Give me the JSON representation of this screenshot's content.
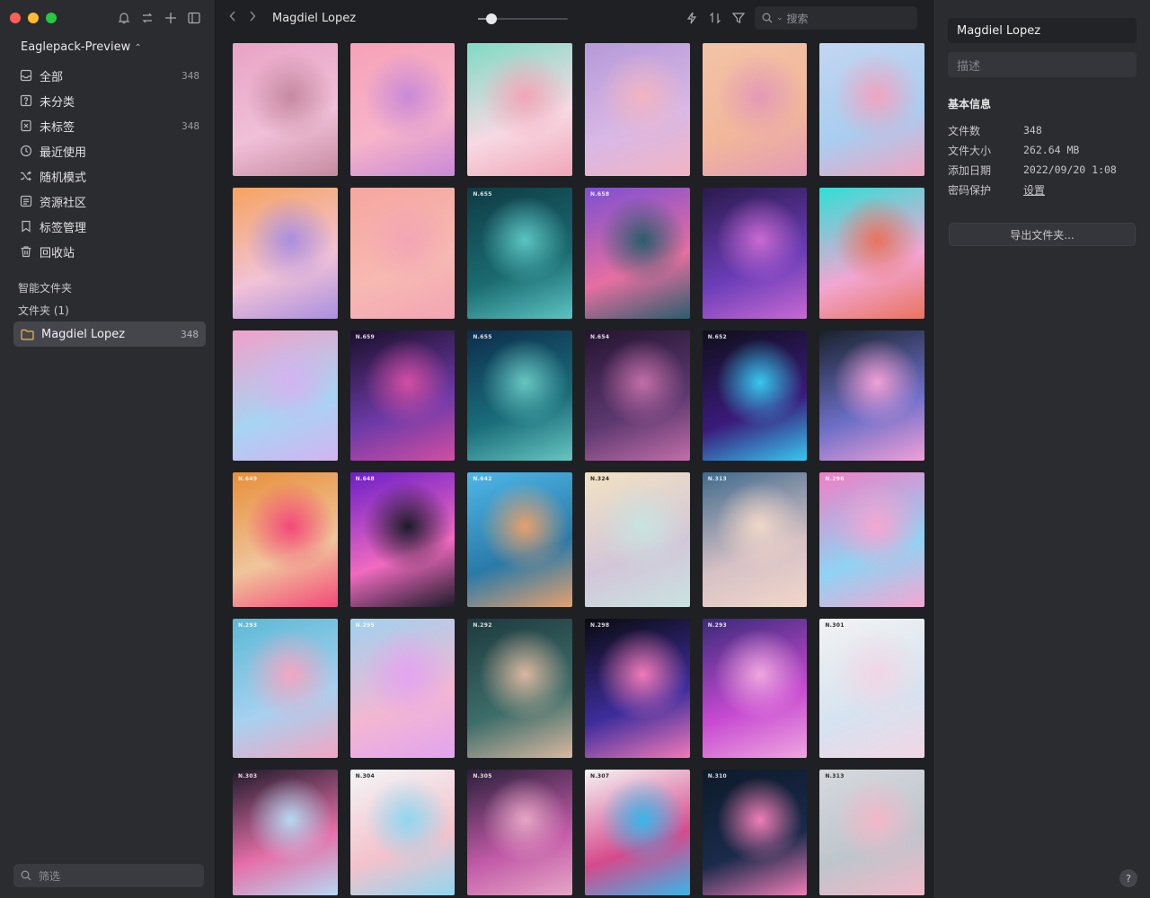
{
  "sidebar": {
    "library_title": "Eaglepack-Preview",
    "nav": [
      {
        "label": "全部",
        "count": "348",
        "icon": "inbox-icon"
      },
      {
        "label": "未分类",
        "count": "",
        "icon": "question-box-icon"
      },
      {
        "label": "未标签",
        "count": "348",
        "icon": "untagged-icon"
      },
      {
        "label": "最近使用",
        "count": "",
        "icon": "clock-icon"
      },
      {
        "label": "随机模式",
        "count": "",
        "icon": "shuffle-icon"
      },
      {
        "label": "资源社区",
        "count": "",
        "icon": "community-icon"
      },
      {
        "label": "标签管理",
        "count": "",
        "icon": "bookmark-icon"
      },
      {
        "label": "回收站",
        "count": "",
        "icon": "trash-icon"
      }
    ],
    "smart_folders_label": "智能文件夹",
    "folders_label": "文件夹 (1)",
    "folder": {
      "label": "Magdiel Lopez",
      "count": "348"
    },
    "filter_placeholder": "筛选"
  },
  "toolbar": {
    "title": "Magdiel Lopez",
    "search_placeholder": "搜索",
    "zoom_level": 0.15
  },
  "grid": {
    "rows": [
      {
        "h": 148,
        "items": [
          {
            "label": "",
            "colors": [
              "#e9a3c6",
              "#f0c0d8",
              "#c68aa0"
            ]
          },
          {
            "label": "",
            "colors": [
              "#f6a2b8",
              "#f7b4c9",
              "#c989d8"
            ]
          },
          {
            "label": "",
            "colors": [
              "#7fdbc4",
              "#f7d9e4",
              "#f1a6b7"
            ]
          },
          {
            "label": "",
            "colors": [
              "#b59ad9",
              "#d9b8e6",
              "#f2b4c3"
            ]
          },
          {
            "label": "",
            "colors": [
              "#f3c3a6",
              "#f2b79b",
              "#e49ab6"
            ]
          },
          {
            "label": "",
            "colors": [
              "#c3d6f1",
              "#a9cdf0",
              "#f0a4c1"
            ]
          }
        ]
      },
      {
        "h": 146,
        "items": [
          {
            "label": "",
            "colors": [
              "#f6a35f",
              "#f2c2d6",
              "#a98fe0"
            ]
          },
          {
            "label": "",
            "colors": [
              "#f6a6a0",
              "#f7b9b2",
              "#f3a5b5"
            ]
          },
          {
            "label": "N.655",
            "colors": [
              "#0f3b44",
              "#1a6b70",
              "#5cc4c3"
            ]
          },
          {
            "label": "N.658",
            "colors": [
              "#7d4fd3",
              "#e66fa0",
              "#2a5d6d"
            ]
          },
          {
            "label": "",
            "colors": [
              "#2a1a4d",
              "#6b3db8",
              "#c86ad2"
            ]
          },
          {
            "label": "",
            "colors": [
              "#2ee0d6",
              "#f2a6d2",
              "#e9735e"
            ]
          }
        ]
      },
      {
        "h": 145,
        "items": [
          {
            "label": "",
            "colors": [
              "#f2a0c9",
              "#a7d4f3",
              "#d3b4f1"
            ]
          },
          {
            "label": "N.659",
            "colors": [
              "#1a0f2a",
              "#6d3aa8",
              "#d24ea3"
            ]
          },
          {
            "label": "N.655",
            "colors": [
              "#0c2d4d",
              "#1a6d7a",
              "#67c6c1"
            ]
          },
          {
            "label": "N.654",
            "colors": [
              "#241431",
              "#5d3870",
              "#c26ea8"
            ]
          },
          {
            "label": "N.652",
            "colors": [
              "#0f0f1a",
              "#3a1a7a",
              "#37c8f0"
            ]
          },
          {
            "label": "",
            "colors": [
              "#18222c",
              "#6d6fc8",
              "#f2a0d8"
            ]
          }
        ]
      },
      {
        "h": 150,
        "items": [
          {
            "label": "N.649",
            "colors": [
              "#e88f3a",
              "#f0c59c",
              "#f3497a"
            ]
          },
          {
            "label": "N.648",
            "colors": [
              "#6d1ec8",
              "#f06ac0",
              "#1c1c2a"
            ]
          },
          {
            "label": "N.642",
            "colors": [
              "#4eb7e8",
              "#2a7aa8",
              "#e6a06d"
            ]
          },
          {
            "label": "N.324",
            "colors": [
              "#f2e2c2",
              "#d3c6d9",
              "#c9e3e0"
            ],
            "light": true
          },
          {
            "label": "N.313",
            "colors": [
              "#3f6a8d",
              "#d7c1c6",
              "#f1d6c9"
            ]
          },
          {
            "label": "N.296",
            "colors": [
              "#f07ec6",
              "#8fd3f3",
              "#f5a6d2"
            ]
          }
        ]
      },
      {
        "h": 155,
        "items": [
          {
            "label": "N.293",
            "colors": [
              "#5bb9d6",
              "#a7d1f0",
              "#f2a6c2"
            ]
          },
          {
            "label": "N.295",
            "colors": [
              "#9fd2ef",
              "#f3b7d2",
              "#e3a3f0"
            ]
          },
          {
            "label": "N.292",
            "colors": [
              "#1e3a3e",
              "#3d6d6a",
              "#d9b8a0"
            ]
          },
          {
            "label": "N.298",
            "colors": [
              "#0a0a0f",
              "#3c2d9c",
              "#f27ab8"
            ]
          },
          {
            "label": "N.293",
            "colors": [
              "#3a2a7a",
              "#c74ad2",
              "#f0a6e0"
            ]
          },
          {
            "label": "N.301",
            "colors": [
              "#f2f2f2",
              "#d6e3f0",
              "#f2d6e6"
            ],
            "light": true
          }
        ]
      },
      {
        "h": 140,
        "items": [
          {
            "label": "N.303",
            "colors": [
              "#1f1a2a",
              "#e56fa8",
              "#b7d8f2"
            ]
          },
          {
            "label": "N.304",
            "colors": [
              "#f3f5f7",
              "#f4c2cc",
              "#8fd7f0"
            ],
            "light": true
          },
          {
            "label": "N.305",
            "colors": [
              "#2a1f3a",
              "#c25aa8",
              "#e6a6c6"
            ]
          },
          {
            "label": "N.307",
            "colors": [
              "#f5f5f5",
              "#d64a8c",
              "#37b6e8"
            ],
            "light": true
          },
          {
            "label": "N.310",
            "colors": [
              "#0d1a2a",
              "#1a2a4a",
              "#f07eb8"
            ]
          },
          {
            "label": "N.313",
            "colors": [
              "#d6d9de",
              "#bfc5cc",
              "#f2b8c9"
            ],
            "light": true
          }
        ]
      }
    ]
  },
  "inspector": {
    "name": "Magdiel Lopez",
    "desc_placeholder": "描述",
    "section_title": "基本信息",
    "info": [
      {
        "key": "文件数",
        "value": "348"
      },
      {
        "key": "文件大小",
        "value": "262.64 MB"
      },
      {
        "key": "添加日期",
        "value": "2022/09/20 1:08"
      },
      {
        "key": "密码保护",
        "value": "设置",
        "link": true
      }
    ],
    "export_label": "导出文件夹...",
    "help_label": "?"
  }
}
